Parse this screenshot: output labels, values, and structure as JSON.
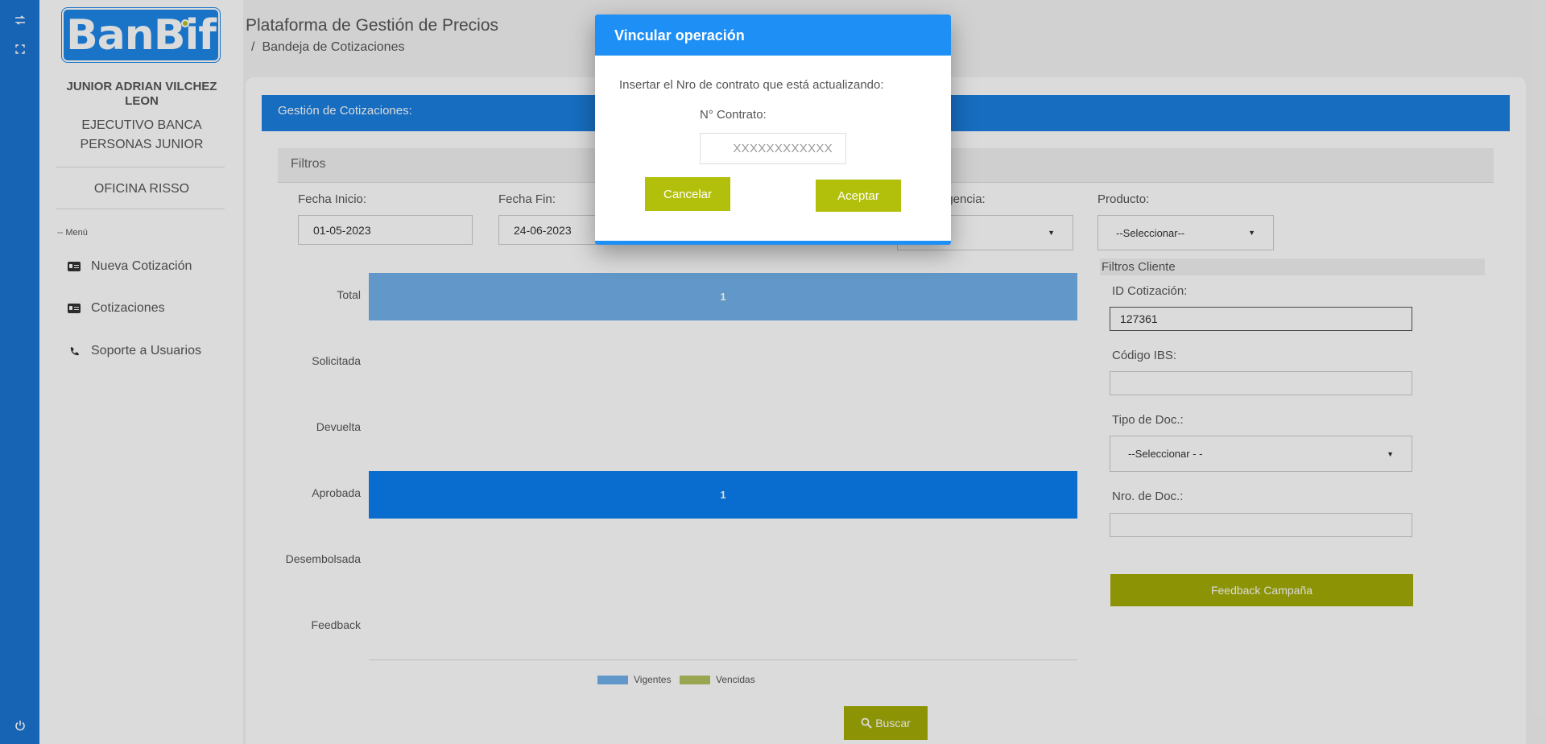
{
  "sidebar": {
    "logo_text": "BanBif",
    "user_name": "JUNIOR ADRIAN VILCHEZ LEON",
    "user_role": "EJECUTIVO BANCA PERSONAS JUNIOR",
    "office": "OFICINA RISSO",
    "menu_caption": "-- Menú",
    "items": [
      {
        "label": "Nueva Cotización",
        "icon": "id-card-icon"
      },
      {
        "label": "Cotizaciones",
        "icon": "id-card-icon"
      },
      {
        "label": "Soporte a Usuarios",
        "icon": "phone-icon"
      }
    ]
  },
  "rail": {
    "icons": [
      "swap-icon",
      "fullscreen-icon",
      "power-icon"
    ]
  },
  "header": {
    "title": "Plataforma de Gestión de Precios",
    "breadcrumb_sep": "/",
    "breadcrumb": "Bandeja de Cotizaciones"
  },
  "panel": {
    "title": "Gestión de Cotizaciones:",
    "filters_title": "Filtros"
  },
  "filters": {
    "fecha_inicio_label": "Fecha Inicio:",
    "fecha_inicio_value": "01-05-2023",
    "fecha_fin_label": "Fecha Fin:",
    "fecha_fin_value": "24-06-2023",
    "vigencia_label_partial": "igencia:",
    "producto_label": "Producto:",
    "producto_value": "--Seleccionar--"
  },
  "client_filters": {
    "title": "Filtros Cliente",
    "id_label": "ID Cotización:",
    "id_value": "127361",
    "ibs_label": "Código IBS:",
    "ibs_value": "",
    "tipo_doc_label": "Tipo de Doc.:",
    "tipo_doc_value": "--Seleccionar - -",
    "nro_doc_label": "Nro. de Doc.:",
    "nro_doc_value": "",
    "feedback_button": "Feedback Campaña"
  },
  "chart_data": {
    "type": "bar",
    "orientation": "horizontal",
    "categories": [
      "Total",
      "Solicitada",
      "Devuelta",
      "Aprobada",
      "Desembolsada",
      "Feedback"
    ],
    "series": [
      {
        "name": "Vigentes",
        "values": [
          1,
          0,
          0,
          1,
          0,
          0
        ]
      },
      {
        "name": "Vencidas",
        "values": [
          0,
          0,
          0,
          0,
          0,
          0
        ]
      }
    ],
    "data_labels": [
      "1",
      "",
      "",
      "1",
      "",
      ""
    ],
    "legend": [
      "Vigentes",
      "Vencidas"
    ],
    "legend_position": "bottom",
    "xlim": [
      0,
      1
    ],
    "colors": {
      "Vigentes": "#73b2ea",
      "Vencidas": "#b4c160",
      "Aprobada": "#0a7ff0"
    }
  },
  "buscar_button": "Buscar",
  "modal": {
    "title": "Vincular operación",
    "prompt": "Insertar el Nro de contrato que está actualizando:",
    "field_label": "N° Contrato:",
    "field_placeholder": "XXXXXXXXXXXX",
    "cancel_label": "Cancelar",
    "accept_label": "Aceptar"
  },
  "colors": {
    "brand_blue": "#1b7fe0",
    "olive": "#a4ad06",
    "modal_btn": "#b2c00c"
  }
}
